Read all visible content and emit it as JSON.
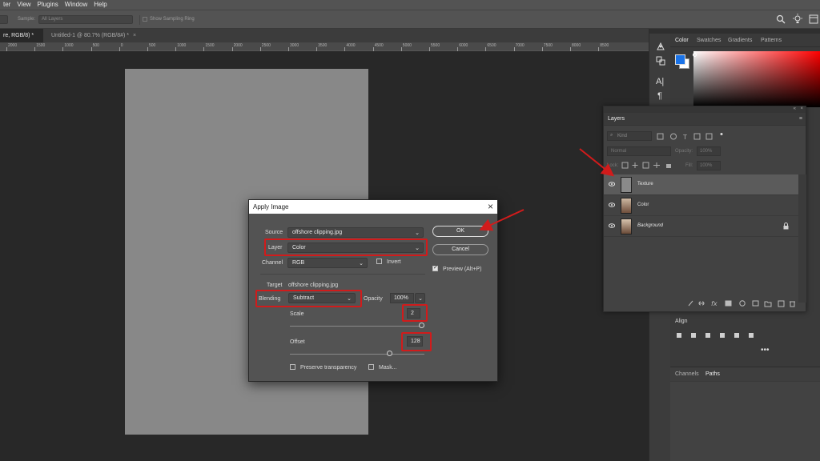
{
  "menu": [
    "ter",
    "View",
    "Plugins",
    "Window",
    "Help"
  ],
  "options": {
    "sample_label": "Sample:",
    "sample_value": "All Layers",
    "show_ring_label": "Show Sampling Ring"
  },
  "tabs": [
    {
      "label": "re, RGB/8) *",
      "active": true
    },
    {
      "label": "Untitled-1 @ 80.7% (RGB/8#) *",
      "active": false
    }
  ],
  "ruler_ticks": [
    "2000",
    "1500",
    "1000",
    "500",
    "0",
    "500",
    "1000",
    "1500",
    "2000",
    "2500",
    "3000",
    "3500",
    "4000",
    "4500",
    "5000",
    "5500",
    "6000",
    "6500",
    "7000",
    "7500",
    "8000",
    "8500"
  ],
  "right_panel": {
    "tabs": [
      "Color",
      "Swatches",
      "Gradients",
      "Patterns"
    ],
    "align_label": "Align",
    "bottom_tabs": [
      "Channels",
      "Paths"
    ],
    "colors": {
      "foreground": "#1a73e8",
      "background": "#ffffff"
    }
  },
  "layers_panel": {
    "tab": "Layers",
    "kind_placeholder": "Kind",
    "blend_mode": "Normal",
    "opacity_label": "Opacity:",
    "opacity_value": "100%",
    "lock_label": "Lock:",
    "fill_label": "Fill:",
    "fill_value": "100%",
    "layers": [
      {
        "name": "Texture",
        "selected": true
      },
      {
        "name": "Color",
        "selected": false
      },
      {
        "name": "Background",
        "selected": false
      }
    ]
  },
  "dialog": {
    "title": "Apply Image",
    "close": "×",
    "source_label": "Source",
    "source_value": "offshore clipping.jpg",
    "layer_label": "Layer",
    "layer_value": "Color",
    "channel_label": "Channel",
    "channel_value": "RGB",
    "invert_label": "Invert",
    "target_label": "Target",
    "target_value": "offshore clipping.jpg",
    "blending_label": "Blending",
    "blending_value": "Subtract",
    "opacity_label": "Opacity",
    "opacity_value": "100%",
    "scale_label": "Scale",
    "scale_value": "2",
    "offset_label": "Offset",
    "offset_value": "128",
    "preserve_label": "Preserve transparency",
    "mask_label": "Mask...",
    "ok_label": "OK",
    "cancel_label": "Cancel",
    "preview_label": "Preview (Alt+P)",
    "preview_checked": true
  },
  "colors": {
    "highlight": "#d11b1b",
    "doc_fill": "#888888"
  }
}
